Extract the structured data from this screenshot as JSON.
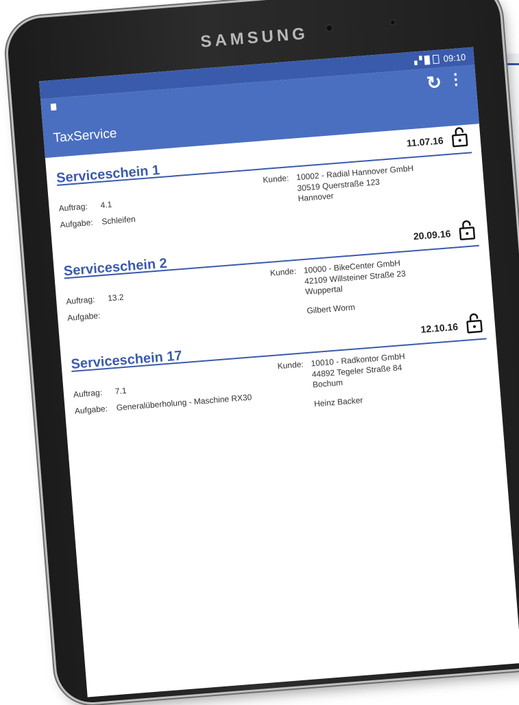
{
  "device": {
    "brand": "SAMSUNG"
  },
  "status_bar": {
    "signal": "▖▘█",
    "time": "09:10"
  },
  "app_bar": {
    "title": "TaxService",
    "refresh_icon": "refresh-icon",
    "menu_icon": "more-vert-icon"
  },
  "labels": {
    "auftrag": "Auftrag:",
    "aufgabe": "Aufgabe:",
    "kunde": "Kunde:"
  },
  "cards": [
    {
      "date": "11.07.16",
      "title": "Serviceschein 1",
      "auftrag": "4.1",
      "aufgabe": "Schleifen",
      "kunde_line1": "10002  -  Radial Hannover GmbH",
      "kunde_line2": "30519 Querstraße 123",
      "kunde_line3": "Hannover",
      "kontakt": ""
    },
    {
      "date": "20.09.16",
      "title": "Serviceschein 2",
      "auftrag": "13.2",
      "aufgabe": "",
      "kunde_line1": "10000  -  BikeCenter GmbH",
      "kunde_line2": "42109 Willsteiner Straße 23",
      "kunde_line3": "Wuppertal",
      "kontakt": "Gilbert Worm"
    },
    {
      "date": "12.10.16",
      "title": "Serviceschein 17",
      "auftrag": "7.1",
      "aufgabe": "Generalüberholung - Maschine RX30",
      "kunde_line1": "10010  -  Radkontor GmbH",
      "kunde_line2": "44892 Tegeler Straße 84",
      "kunde_line3": "Bochum",
      "kontakt": "Heinz Backer"
    }
  ],
  "colors": {
    "appbar": "#4a6fc0",
    "statusbar": "#3a5bac",
    "accent": "#3a5bac"
  }
}
